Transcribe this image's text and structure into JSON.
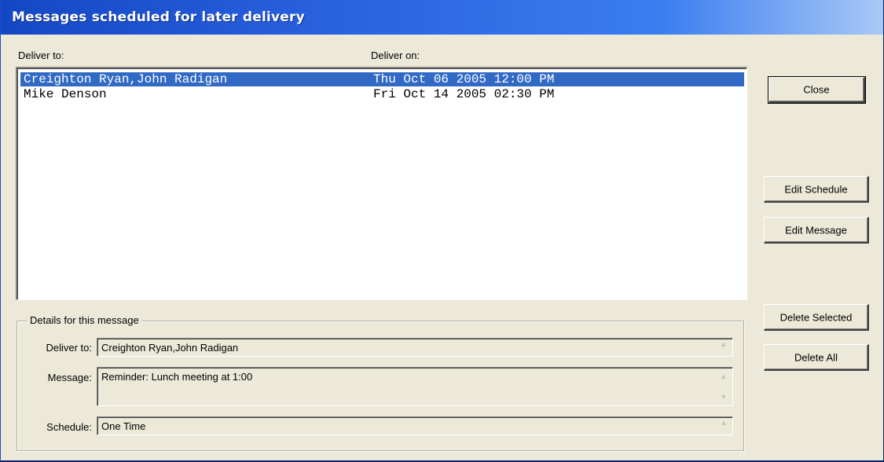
{
  "window": {
    "title": "Messages scheduled for later delivery"
  },
  "list": {
    "headers": {
      "deliver_to": "Deliver to:",
      "deliver_on": "Deliver on:"
    },
    "rows": [
      {
        "deliver_to": "Creighton Ryan,John Radigan",
        "deliver_on": "Thu Oct 06 2005 12:00 PM",
        "selected": true
      },
      {
        "deliver_to": "Mike Denson",
        "deliver_on": "Fri Oct 14 2005 02:30 PM",
        "selected": false
      }
    ],
    "selection_color": "#316ac5"
  },
  "buttons": {
    "close": "Close",
    "edit_schedule": "Edit Schedule",
    "edit_message": "Edit Message",
    "delete_selected": "Delete Selected",
    "delete_all": "Delete All"
  },
  "details": {
    "legend": "Details for this message",
    "deliver_to_label": "Deliver to:",
    "deliver_to_value": "Creighton Ryan,John Radigan",
    "message_label": "Message:",
    "message_value": "Reminder: Lunch meeting at 1:00",
    "schedule_label": "Schedule:",
    "schedule_value": "One Time"
  },
  "icons": {
    "spin_up": "up-arrow-icon",
    "spin_down": "down-arrow-icon"
  }
}
